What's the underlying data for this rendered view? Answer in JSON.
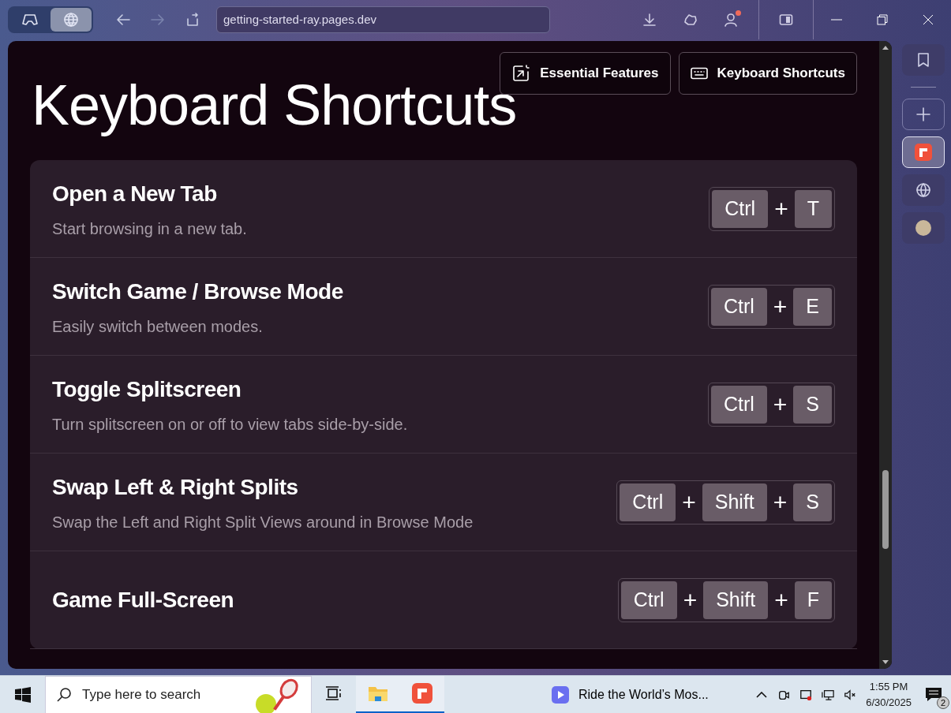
{
  "browser": {
    "modes": [
      {
        "kind": "game",
        "selected": false
      },
      {
        "kind": "browse",
        "selected": true
      }
    ],
    "nav": [
      {
        "kind": "back",
        "disabled": false
      },
      {
        "kind": "forward",
        "disabled": true
      },
      {
        "kind": "reload",
        "disabled": false
      }
    ],
    "url": "getting-started-ray.pages.dev",
    "profile": {
      "notification": true
    }
  },
  "page": {
    "title": "Keyboard Shortcuts",
    "nav_buttons": [
      {
        "kind": "features",
        "label": "Essential Features"
      },
      {
        "kind": "keyboard",
        "label": "Keyboard Shortcuts"
      }
    ],
    "shortcuts": [
      {
        "title": "Open a New Tab",
        "description": "Start browsing in a new tab.",
        "keys": [
          {
            "kind": "key",
            "label": "Ctrl"
          },
          {
            "kind": "plus",
            "label": "+"
          },
          {
            "kind": "key",
            "label": "T"
          }
        ]
      },
      {
        "title": "Switch Game / Browse Mode",
        "description": "Easily switch between modes.",
        "keys": [
          {
            "kind": "key",
            "label": "Ctrl"
          },
          {
            "kind": "plus",
            "label": "+"
          },
          {
            "kind": "key",
            "label": "E"
          }
        ]
      },
      {
        "title": "Toggle Splitscreen",
        "description": "Turn splitscreen on or off to view tabs side-by-side.",
        "keys": [
          {
            "kind": "key",
            "label": "Ctrl"
          },
          {
            "kind": "plus",
            "label": "+"
          },
          {
            "kind": "key",
            "label": "S"
          }
        ]
      },
      {
        "title": "Swap Left & Right Splits",
        "description": "Swap the Left and Right Split Views around in Browse Mode",
        "keys": [
          {
            "kind": "key",
            "label": "Ctrl"
          },
          {
            "kind": "plus",
            "label": "+"
          },
          {
            "kind": "key",
            "label": "Shift"
          },
          {
            "kind": "plus",
            "label": "+"
          },
          {
            "kind": "key",
            "label": "S"
          }
        ]
      },
      {
        "title": "Game Full-Screen",
        "keys": [
          {
            "kind": "key",
            "label": "Ctrl"
          },
          {
            "kind": "plus",
            "label": "+"
          },
          {
            "kind": "key",
            "label": "Shift"
          },
          {
            "kind": "plus",
            "label": "+"
          },
          {
            "kind": "key",
            "label": "F"
          }
        ]
      }
    ]
  },
  "sidebar": [
    {
      "kind": "bookmark",
      "selected": false
    },
    {
      "kind": "add",
      "selected": false
    },
    {
      "kind": "app",
      "selected": true
    },
    {
      "kind": "globe",
      "selected": false
    },
    {
      "kind": "avatar",
      "selected": false
    }
  ],
  "taskbar": {
    "search_placeholder": "Type here to search",
    "apps": [
      {
        "kind": "taskview",
        "active": false
      },
      {
        "kind": "folder",
        "active": true
      },
      {
        "kind": "app",
        "active": true
      }
    ],
    "media": "Ride the World’s Mos...",
    "time": "1:55 PM",
    "date": "6/30/2025",
    "notifications": "2"
  }
}
